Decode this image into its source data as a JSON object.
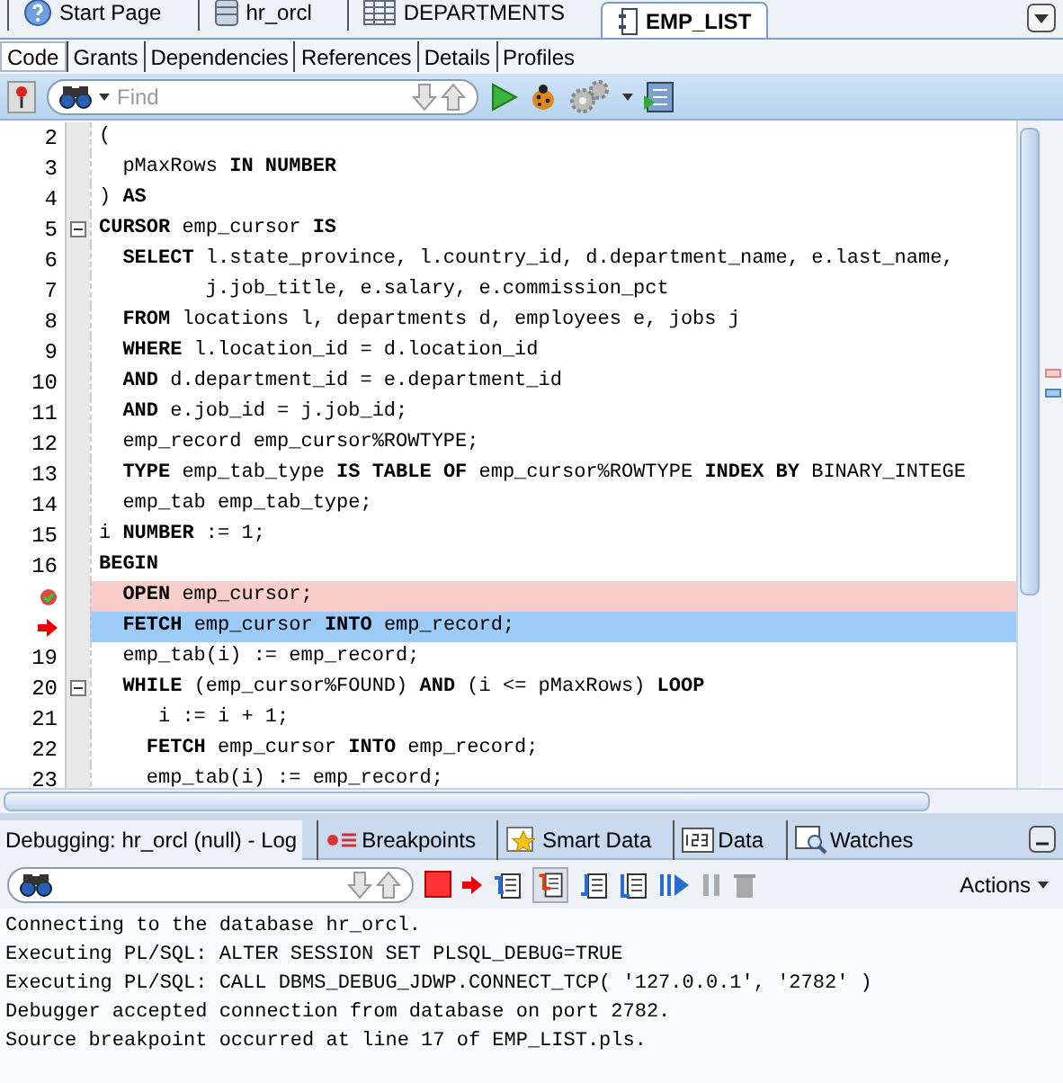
{
  "editor_tabs": [
    {
      "label": "Start Page",
      "selected": false
    },
    {
      "label": "hr_orcl",
      "selected": false
    },
    {
      "label": "DEPARTMENTS",
      "selected": false
    },
    {
      "label": "EMP_LIST",
      "selected": true
    }
  ],
  "sub_tabs": [
    {
      "label": "Code",
      "selected": true
    },
    {
      "label": "Grants",
      "selected": false
    },
    {
      "label": "Dependencies",
      "selected": false
    },
    {
      "label": "References",
      "selected": false
    },
    {
      "label": "Details",
      "selected": false
    },
    {
      "label": "Profiles",
      "selected": false
    }
  ],
  "find": {
    "placeholder": "Find"
  },
  "code_lines": [
    {
      "kind": "code",
      "number": "2",
      "text": "(",
      "foldable": false
    },
    {
      "kind": "code",
      "number": "3",
      "text": "  pMaxRows **IN NUMBER**",
      "foldable": false
    },
    {
      "kind": "code",
      "number": "4",
      "text": ") **AS**",
      "foldable": false
    },
    {
      "kind": "code",
      "number": "5",
      "text": "**CURSOR** emp_cursor **IS**",
      "foldable": true
    },
    {
      "kind": "code",
      "number": "6",
      "text": "  **SELECT** l.state_province, l.country_id, d.department_name, e.last_name,",
      "foldable": false
    },
    {
      "kind": "code",
      "number": "7",
      "text": "         j.job_title, e.salary, e.commission_pct",
      "foldable": false
    },
    {
      "kind": "code",
      "number": "8",
      "text": "  **FROM** locations l, departments d, employees e, jobs j",
      "foldable": false
    },
    {
      "kind": "code",
      "number": "9",
      "text": "  **WHERE** l.location_id = d.location_id",
      "foldable": false
    },
    {
      "kind": "code",
      "number": "10",
      "text": "  **AND** d.department_id = e.department_id",
      "foldable": false
    },
    {
      "kind": "code",
      "number": "11",
      "text": "  **AND** e.job_id = j.job_id;",
      "foldable": false
    },
    {
      "kind": "code",
      "number": "12",
      "text": "  emp_record emp_cursor%ROWTYPE;",
      "foldable": false
    },
    {
      "kind": "code",
      "number": "13",
      "text": "  **TYPE** emp_tab_type **IS TABLE OF** emp_cursor%ROWTYPE **INDEX BY** BINARY_INTEGE",
      "foldable": false
    },
    {
      "kind": "code",
      "number": "14",
      "text": "  emp_tab emp_tab_type;",
      "foldable": false
    },
    {
      "kind": "code",
      "number": "15",
      "text": "i **NUMBER** := 1;",
      "foldable": false
    },
    {
      "kind": "code",
      "number": "16",
      "text": "**BEGIN**",
      "foldable": false
    },
    {
      "kind": "breakpoint",
      "text": "  **OPEN** emp_cursor;",
      "foldable": false
    },
    {
      "kind": "current",
      "text": "  **FETCH** emp_cursor **INTO** emp_record;",
      "foldable": false
    },
    {
      "kind": "code",
      "number": "19",
      "text": "  emp_tab(i) := emp_record;",
      "foldable": false
    },
    {
      "kind": "code",
      "number": "20",
      "text": "  **WHILE** (emp_cursor%FOUND) **AND** (i <= pMaxRows) **LOOP**",
      "foldable": true
    },
    {
      "kind": "code",
      "number": "21",
      "text": "     i := i + 1;",
      "foldable": false
    },
    {
      "kind": "code",
      "number": "22",
      "text": "    **FETCH** emp_cursor **INTO** emp_record;",
      "foldable": false
    },
    {
      "kind": "code",
      "number": "23",
      "text": "    emp_tab(i) := emp_record;",
      "foldable": false
    }
  ],
  "bottom_tabs": [
    {
      "label": "Debugging: hr_orcl (null) - Log",
      "selected": true
    },
    {
      "label": "Breakpoints",
      "selected": false
    },
    {
      "label": "Smart Data",
      "selected": false
    },
    {
      "label": "Data",
      "selected": false
    },
    {
      "label": "Watches",
      "selected": false
    }
  ],
  "actions_menu": "Actions",
  "log_lines": [
    "Connecting to the database hr_orcl.",
    "Executing PL/SQL: ALTER SESSION SET PLSQL_DEBUG=TRUE",
    "Executing PL/SQL: CALL DBMS_DEBUG_JDWP.CONNECT_TCP( '127.0.0.1', '2782' )",
    "Debugger accepted connection from database on port 2782.",
    "Source breakpoint occurred at line 17 of EMP_LIST.pls."
  ]
}
